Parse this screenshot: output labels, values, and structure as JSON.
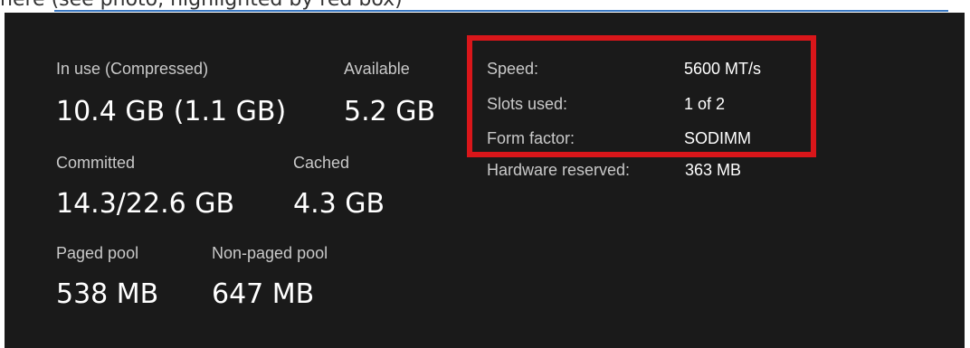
{
  "caption": "here (see photo, highlighted by red box)",
  "stats": {
    "in_use_label": "In use (Compressed)",
    "in_use_value": "10.4 GB (1.1 GB)",
    "available_label": "Available",
    "available_value": "5.2 GB",
    "committed_label": "Committed",
    "committed_value": "14.3/22.6 GB",
    "cached_label": "Cached",
    "cached_value": "4.3 GB",
    "paged_pool_label": "Paged pool",
    "paged_pool_value": "538 MB",
    "non_paged_pool_label": "Non-paged pool",
    "non_paged_pool_value": "647 MB"
  },
  "details": {
    "speed_label": "Speed:",
    "speed_value": "5600 MT/s",
    "slots_label": "Slots used:",
    "slots_value": "1 of 2",
    "form_factor_label": "Form factor:",
    "form_factor_value": "SODIMM",
    "hw_reserved_label": "Hardware reserved:",
    "hw_reserved_value": "363 MB"
  },
  "colors": {
    "panel_background": "#1a1a1a",
    "highlight_box": "#d9161a",
    "caption_underline": "#3a78c2"
  }
}
